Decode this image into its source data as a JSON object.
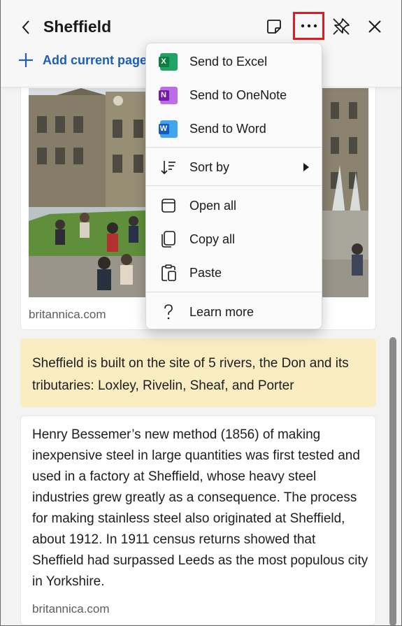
{
  "header": {
    "title": "Sheffield",
    "add_label": "Add current page",
    "icons": {
      "back": "chevron-left-icon",
      "note": "sticky-note-icon",
      "more": "more-horizontal-icon",
      "pin": "unpin-icon",
      "close": "close-icon"
    },
    "highlight_color": "#e01b24"
  },
  "image_card": {
    "source": "britannica.com"
  },
  "note_card": {
    "text": "Sheffield is built on the site of 5 rivers, the Don and its tributaries: Loxley, Rivelin, Sheaf, and Porter",
    "background": "#faedc2"
  },
  "text_card": {
    "text": "Henry Bessemer’s new method (1856) of making inexpensive steel in large quantities was first tested and used in a factory at Sheffield, whose heavy steel industries grew greatly as a consequence. The process for making stainless steel also originated at Sheffield, about 1912. In 1911 census returns showed that Sheffield had surpassed Leeds as the most populous city in Yorkshire.",
    "source": "britannica.com"
  },
  "menu": {
    "items": [
      {
        "label": "Send to Excel",
        "icon": "excel-icon",
        "color": "#107c41",
        "letter": "X"
      },
      {
        "label": "Send to OneNote",
        "icon": "onenote-icon",
        "color": "#7719aa",
        "letter": "N"
      },
      {
        "label": "Send to Word",
        "icon": "word-icon",
        "color": "#185abd",
        "letter": "W"
      },
      {
        "label": "Sort by",
        "icon": "sort-icon"
      },
      {
        "label": "Open all",
        "icon": "open-all-icon"
      },
      {
        "label": "Copy all",
        "icon": "copy-icon"
      },
      {
        "label": "Paste",
        "icon": "paste-icon"
      },
      {
        "label": "Learn more",
        "icon": "question-icon"
      }
    ]
  }
}
